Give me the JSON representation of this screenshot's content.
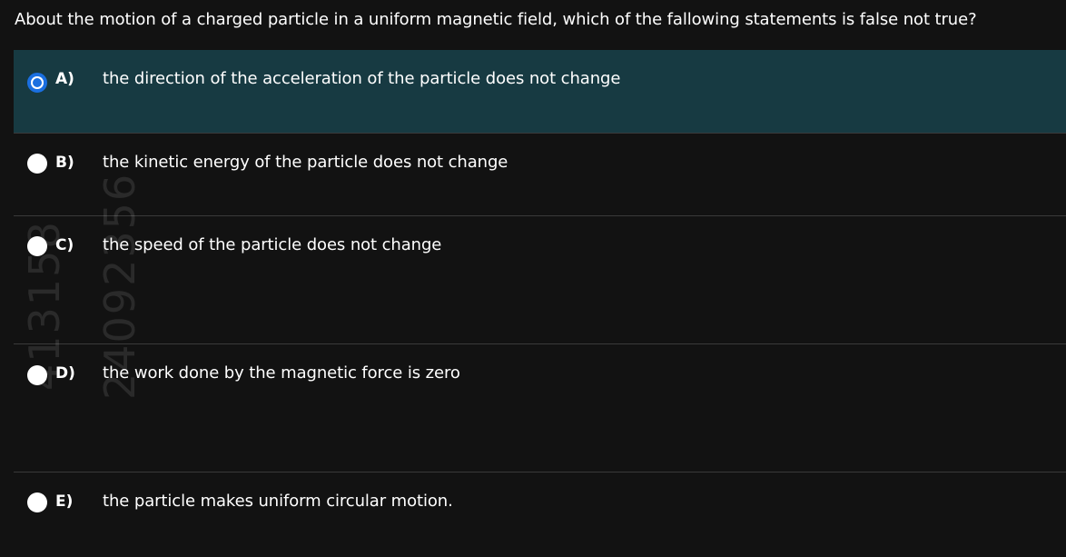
{
  "question": "About the motion of a charged particle in a uniform magnetic field, which of the fallowing statements is false not true?",
  "options": [
    {
      "letter": "A)",
      "text": "the direction of the acceleration of the particle does not change",
      "selected": true
    },
    {
      "letter": "B)",
      "text": "the kinetic energy of the particle does not change",
      "selected": false
    },
    {
      "letter": "C)",
      "text": "the speed of the particle does not change",
      "selected": false
    },
    {
      "letter": "D)",
      "text": "the work done by the magnetic force is zero",
      "selected": false
    },
    {
      "letter": "E)",
      "text": "the particle makes uniform circular motion.",
      "selected": false
    }
  ],
  "watermark": {
    "line1": "413158",
    "line2": "24092356"
  },
  "colors": {
    "background": "#121212",
    "selected_background": "#173a42",
    "radio_checked": "#1a6fe0",
    "separator": "#3a3a3a"
  }
}
